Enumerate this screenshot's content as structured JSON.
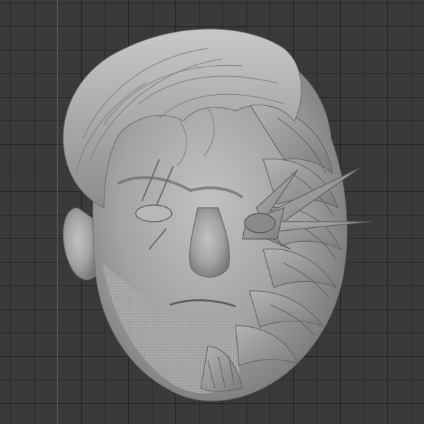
{
  "viewport": {
    "background_color": "#3a3a3a",
    "grid_color": "#262626",
    "axis_color": "#3d5a8c"
  },
  "model": {
    "material_color": "#9a9a9a",
    "shadow_color": "#6e6e6e",
    "highlight_color": "#c6c6c6"
  }
}
